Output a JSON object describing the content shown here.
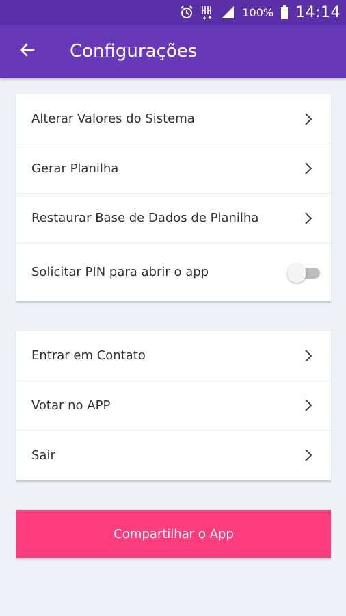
{
  "status_bar": {
    "battery": "100%",
    "time": "14:14",
    "icons": [
      "alarm-icon",
      "data-arrows-icon",
      "signal-icon",
      "battery-icon"
    ]
  },
  "app_bar": {
    "title": "Configurações",
    "back_icon": "arrow-left-icon"
  },
  "settings_group": [
    {
      "label": "Alterar Valores do Sistema",
      "control": "chevron"
    },
    {
      "label": "Gerar Planilha",
      "control": "chevron"
    },
    {
      "label": "Restaurar Base de Dados de Planilha",
      "control": "chevron"
    },
    {
      "label": "Solicitar PIN para abrir o app",
      "control": "toggle",
      "enabled": false
    }
  ],
  "support_group": [
    {
      "label": "Entrar em Contato",
      "control": "chevron"
    },
    {
      "label": "Votar no APP",
      "control": "chevron"
    },
    {
      "label": "Sair",
      "control": "chevron"
    }
  ],
  "share_button": {
    "label": "Compartilhar o App"
  },
  "colors": {
    "status_bar": "#5a2fa8",
    "app_bar": "#6738b8",
    "accent": "#fe3d7e",
    "background": "#eef1f6"
  }
}
